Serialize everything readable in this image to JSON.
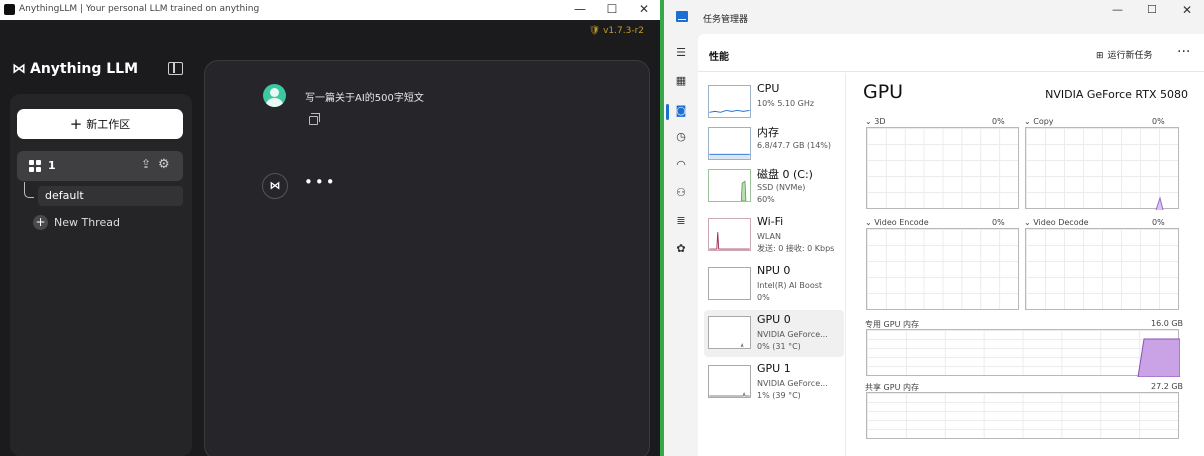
{
  "left_window": {
    "title": "AnythingLLM | Your personal LLM trained on anything",
    "controls": {
      "minimize": "—",
      "maximize": "☐",
      "close": "✕"
    },
    "version": "v1.7.3-r2",
    "logo_text": "Anything LLM",
    "new_workspace": "新工作区",
    "workspace_name": "1",
    "thread_default": "default",
    "new_thread": "New Thread",
    "user_message": "写一篇关于AI的500字短文",
    "typing_indicator": "•••"
  },
  "right_window": {
    "title": "任务管理器",
    "controls": {
      "minimize": "—",
      "maximize": "☐",
      "close": "✕"
    },
    "page_title": "性能",
    "run_new_task": "运行新任务",
    "more": "···",
    "devices": [
      {
        "name": "CPU",
        "line1": "10% 5.10 GHz",
        "line2": ""
      },
      {
        "name": "内存",
        "line1": "6.8/47.7 GB (14%)",
        "line2": ""
      },
      {
        "name": "磁盘 0 (C:)",
        "line1": "SSD (NVMe)",
        "line2": "60%"
      },
      {
        "name": "Wi-Fi",
        "line1": "WLAN",
        "line2": "发送: 0 接收: 0 Kbps"
      },
      {
        "name": "NPU 0",
        "line1": "Intel(R) AI Boost",
        "line2": "0%"
      },
      {
        "name": "GPU 0",
        "line1": "NVIDIA GeForce...",
        "line2": "0% (31 °C)"
      },
      {
        "name": "GPU 1",
        "line1": "NVIDIA GeForce...",
        "line2": "1% (39 °C)"
      }
    ],
    "gpu": {
      "heading": "GPU",
      "model": "NVIDIA GeForce RTX 5080",
      "engines": [
        {
          "label": "3D",
          "pct": "0%"
        },
        {
          "label": "Copy",
          "pct": "0%"
        },
        {
          "label": "Video Encode",
          "pct": "0%"
        },
        {
          "label": "Video Decode",
          "pct": "0%"
        }
      ],
      "dedicated_label": "专用 GPU 内存",
      "dedicated_max": "16.0 GB",
      "shared_label": "共享 GPU 内存",
      "shared_max": "27.2 GB"
    }
  },
  "colors": {
    "accent": "#1c6fd1",
    "divider": "#36a84a",
    "gpu_mem": "#c9a3e6",
    "version": "#c49c2a"
  }
}
